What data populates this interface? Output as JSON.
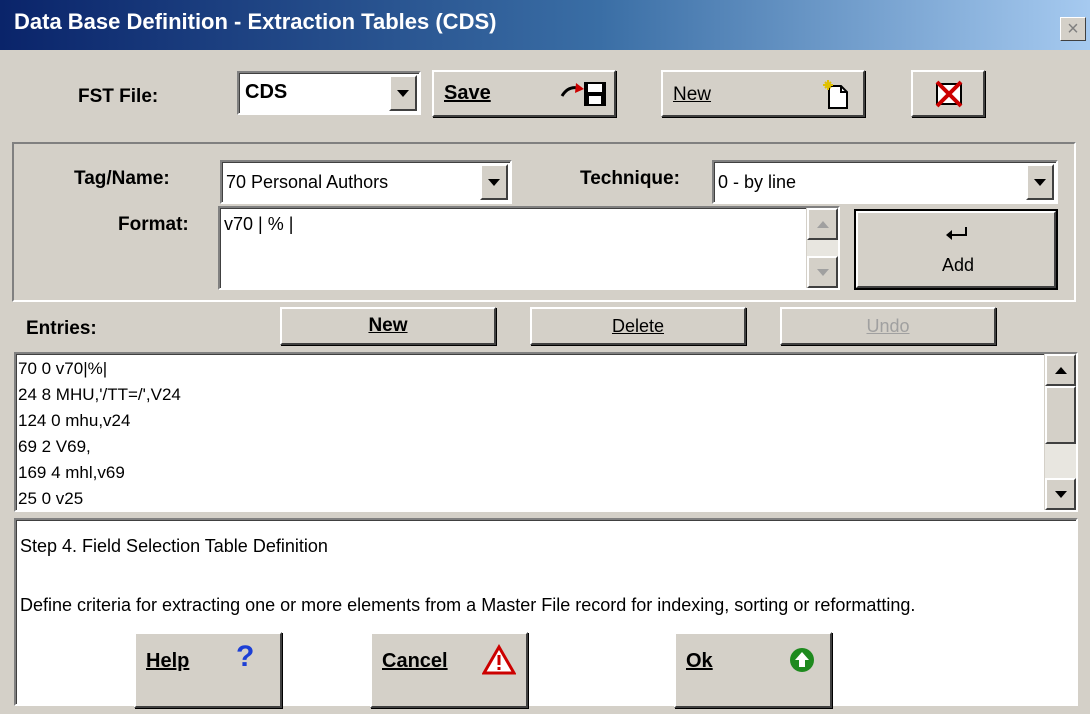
{
  "window": {
    "title": "Data Base Definition - Extraction Tables (CDS)",
    "close_glyph": "×"
  },
  "fst": {
    "label": "FST File:",
    "selected": "CDS",
    "save_label": "Save",
    "new_label": "New"
  },
  "editor": {
    "tag_label": "Tag/Name:",
    "tag_value": "70 Personal Authors",
    "technique_label": "Technique:",
    "technique_value": "0 - by line",
    "format_label": "Format:",
    "format_value": "v70 | % |",
    "add_label": "Add"
  },
  "entries": {
    "label": "Entries:",
    "new_label": "New",
    "delete_label": "Delete",
    "undo_label": "Undo",
    "items": [
      "70 0 v70|%|",
      "24 8 MHU,'/TT=/',V24",
      "124 0 mhu,v24",
      "69 2 V69,",
      "169 4 mhl,v69",
      "25 0 v25"
    ]
  },
  "help": {
    "heading": "Step 4. Field Selection Table Definition",
    "body": "Define criteria for extracting one or more elements from a Master File record for indexing, sorting or reformatting."
  },
  "footer": {
    "help_label": "Help",
    "cancel_label": "Cancel",
    "ok_label": "Ok"
  },
  "colors": {
    "title_start": "#0a246a",
    "title_end": "#a6caf0",
    "ok_icon": "#1e8a1e",
    "warn_icon": "#cc0000"
  }
}
